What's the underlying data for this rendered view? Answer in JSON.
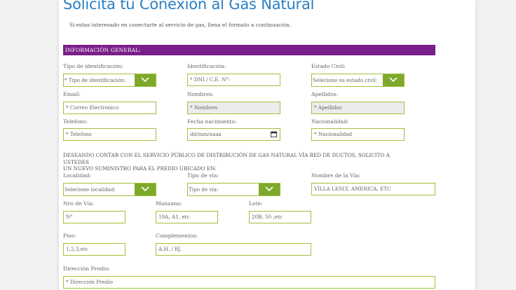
{
  "header": {
    "title": "Solicita tu Conexión al Gas Natural",
    "subtitle": "Si estas interesado en conectarte al servicio de gas, llena el formato a continuación."
  },
  "section": {
    "title": "INFORMACIÓN GENERAL:"
  },
  "fields": {
    "tipo_id": {
      "label": "Tipo de identificación:",
      "value": "* Tipo de identificación:"
    },
    "identificacion": {
      "label": "Identificación:",
      "placeholder": "* DNI / C.E. N°:"
    },
    "estado_civil": {
      "label": "Estado Civil:",
      "value": "Selecione su estado civil:"
    },
    "email": {
      "label": "Email:",
      "placeholder": "* Correo Electronico"
    },
    "nombres": {
      "label": "Nombres:",
      "placeholder": "* Nombres"
    },
    "apellidos": {
      "label": "Apellidos:",
      "placeholder": "* Apellidos"
    },
    "telefono": {
      "label": "Telefono:",
      "placeholder": "* Telefono"
    },
    "fecha": {
      "label": "Fecha nacimiento:",
      "placeholder": "dd/mm/aaaa"
    },
    "nacionalidad": {
      "label": "Nacionalidad:",
      "placeholder": "* Nacionalidad"
    },
    "localidad": {
      "label": "Localidad:",
      "value": "Selecione localidad:"
    },
    "tipo_via": {
      "label": "Tipo de vía:",
      "value": "Tipo de vía:"
    },
    "nombre_via": {
      "label": "Nombre de la Vía:",
      "placeholder": "VILLA LESLY, AMERICA, ETC"
    },
    "nro_via": {
      "label": "Nro de Vía:",
      "placeholder": "N°"
    },
    "manzana": {
      "label": "Manzana:",
      "placeholder": "19A, A1, etc"
    },
    "lote": {
      "label": "Lote:",
      "placeholder": "20B, 50 ,etc"
    },
    "piso": {
      "label": "Piso:",
      "placeholder": "1,2,3,etc"
    },
    "complementos": {
      "label": "Complementos:",
      "placeholder": "A.H. / RJ."
    },
    "direccion": {
      "label": "Dirección Predio:",
      "placeholder": "* Dirección Predio"
    }
  },
  "notice": {
    "line1": "DESEANDO CONTAR CON EL SERVICIO PÚBLICO DE DISTRIBUCIÓN DE GAS NATURAL VÍA RED DE DUCTOS, SOLICITO A USTEDES",
    "line2": "UN NUEVO SUMINISTRO PARA EL PREDIO UBICADO EN:"
  },
  "colors": {
    "title": "#2a7fc4",
    "section_bar": "#7a1f8a",
    "field_border": "#9ec23a",
    "select_arrow": "#7ea92a"
  },
  "icons": {
    "select_arrow": "chevron-down-icon",
    "date": "calendar-icon"
  }
}
